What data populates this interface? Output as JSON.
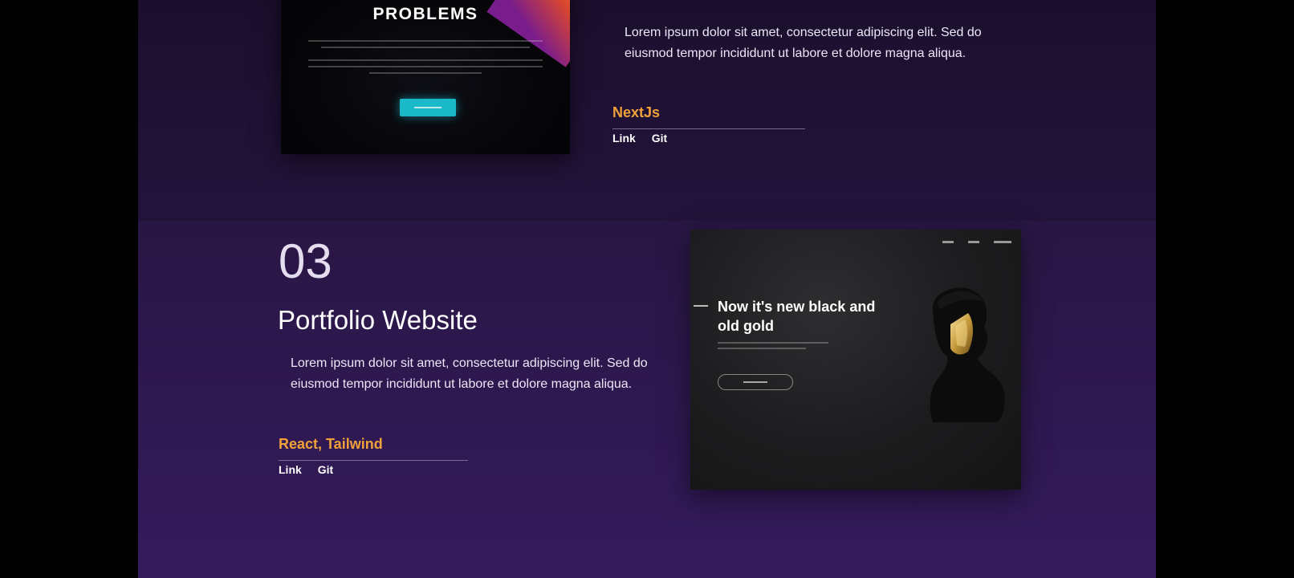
{
  "project_prev": {
    "thumbnail": {
      "headline": "PROBLEMS"
    },
    "description": "Lorem ipsum dolor sit amet, consectetur adipiscing elit. Sed do eiusmod tempor incididunt ut labore et dolore magna aliqua.",
    "tech": "NextJs",
    "links": {
      "link": "Link",
      "git": "Git"
    }
  },
  "project_3": {
    "number": "03",
    "title": "Portfolio Website",
    "description": "Lorem ipsum dolor sit amet, consectetur adipiscing elit. Sed do eiusmod tempor incididunt ut labore et dolore magna aliqua.",
    "tech": "React, Tailwind",
    "links": {
      "link": "Link",
      "git": "Git"
    },
    "thumbnail": {
      "hero": "Now it's new black and old gold"
    }
  },
  "colors": {
    "accent": "#f0a13a",
    "background": "#2a1747"
  }
}
